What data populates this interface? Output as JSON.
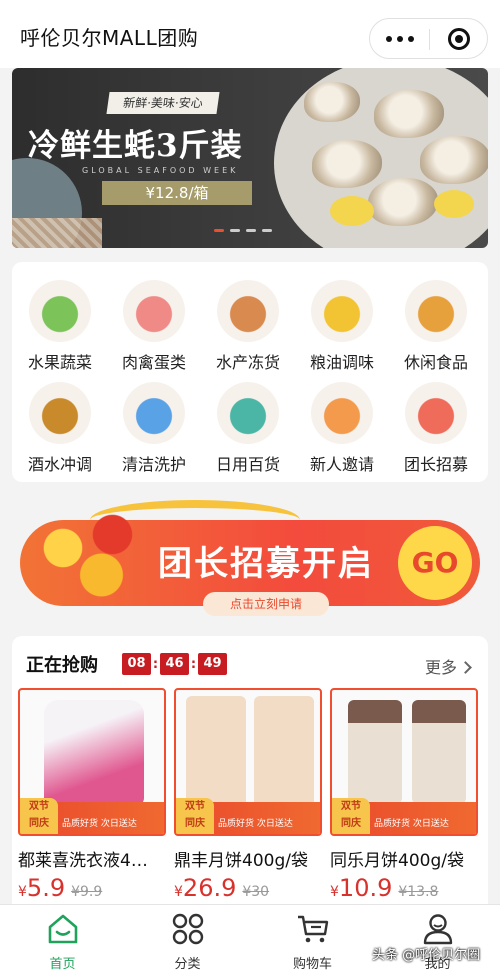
{
  "header": {
    "title": "呼伦贝尔MALL团购"
  },
  "banner": {
    "tag": "新鲜·美味·安心",
    "title": "冷鲜生蚝3斤装",
    "subtitle": "GLOBAL SEAFOOD WEEK",
    "price": "¥12.8/箱",
    "active_slide": 1,
    "slide_count": 4
  },
  "categories": [
    {
      "label": "水果蔬菜",
      "icon": "vegetables-icon",
      "color": "#7cc35a"
    },
    {
      "label": "肉禽蛋类",
      "icon": "meat-icon",
      "color": "#f08a86"
    },
    {
      "label": "水产冻货",
      "icon": "seafood-icon",
      "color": "#d98a4e"
    },
    {
      "label": "粮油调味",
      "icon": "oil-icon",
      "color": "#f2c433"
    },
    {
      "label": "休闲食品",
      "icon": "snacks-icon",
      "color": "#e7a13c"
    },
    {
      "label": "酒水冲调",
      "icon": "drinks-icon",
      "color": "#c98a2c"
    },
    {
      "label": "清洁洗护",
      "icon": "cleaning-icon",
      "color": "#5aa2e6"
    },
    {
      "label": "日用百货",
      "icon": "daily-goods-icon",
      "color": "#4bb6a5"
    },
    {
      "label": "新人邀请",
      "icon": "gift-icon",
      "color": "#f39a4c"
    },
    {
      "label": "团长招募",
      "icon": "recruit-icon",
      "color": "#ef6b5a"
    }
  ],
  "recruit": {
    "title": "团长招募开启",
    "go": "GO",
    "apply": "点击立刻申请"
  },
  "flash_sale": {
    "title": "正在抢购",
    "timer": {
      "h": "08",
      "m": "46",
      "s": "49"
    },
    "more": "更多",
    "products": [
      {
        "name": "都莱喜洗衣液4…",
        "currency": "¥",
        "price": "5.9",
        "old_price": "¥9.9",
        "badge_1": "双节",
        "badge_2": "同庆",
        "strip": "品质好货 次日送达",
        "color": "#e0578f"
      },
      {
        "name": "鼎丰月饼400g/袋",
        "currency": "¥",
        "price": "26.9",
        "old_price": "¥30",
        "badge_1": "双节",
        "badge_2": "同庆",
        "strip": "品质好货 次日送达",
        "color": "#f2dcc5"
      },
      {
        "name": "同乐月饼400g/袋",
        "currency": "¥",
        "price": "10.9",
        "old_price": "¥13.8",
        "badge_1": "双节",
        "badge_2": "同庆",
        "strip": "品质好货 次日送达",
        "color": "#e9dfd2"
      }
    ]
  },
  "tabbar": {
    "items": [
      {
        "label": "首页",
        "icon": "home-icon"
      },
      {
        "label": "分类",
        "icon": "grid-icon"
      },
      {
        "label": "购物车",
        "icon": "cart-icon"
      },
      {
        "label": "我的",
        "icon": "user-icon"
      }
    ],
    "active_color": "#1fa35b"
  },
  "watermark": "头条 @呼伦贝尔圈"
}
